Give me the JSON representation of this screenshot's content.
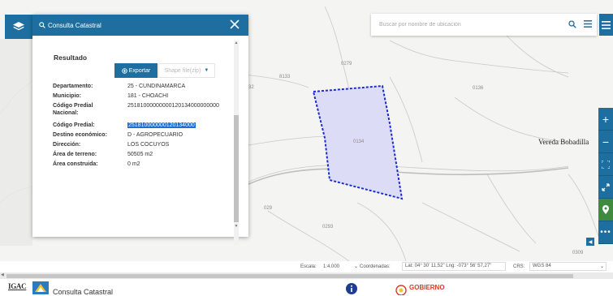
{
  "search": {
    "placeholder": "Buscar por nombre de ubicación"
  },
  "panel": {
    "title": "Consulta Catastral",
    "result_title": "Resultado",
    "export_label": "Exportar",
    "shape_label": "Shape file(zip)",
    "fields": [
      {
        "label": "Departamento:",
        "value": "25 - CUNDINAMARCA"
      },
      {
        "label": "Municipio:",
        "value": "181 - CHOACHÍ"
      },
      {
        "label": "Código Predial Nacional:",
        "value": "25181000000000120134000000000"
      },
      {
        "label": "Código Predial:",
        "value": "251810000000120134000"
      },
      {
        "label": "Destino económico:",
        "value": "D - AGROPECUARIO"
      },
      {
        "label": "Dirección:",
        "value": "LOS COCUYOS"
      },
      {
        "label": "Área de terreno:",
        "value": "50505 m2"
      },
      {
        "label": "Área construida:",
        "value": "0 m2"
      }
    ]
  },
  "map": {
    "labels": [
      "0279",
      "8133",
      "0136",
      "32",
      "0134",
      "029",
      "0293",
      "0309"
    ],
    "place_name": "Vereda Bobadilla",
    "polygon_fill": "#dcdcf7",
    "polygon_stroke": "#1c2bd0"
  },
  "statusbar": {
    "scale_label": "Escala:",
    "scale_value": "1:4.000",
    "coord_label": "Coordenadas:",
    "coord_value": "Lat: 04° 30' 11,52\" Lng: -073° 56' 57,27\"",
    "crs_label": "CRS:",
    "crs_value": "WGS 84"
  },
  "footer": {
    "org": "IGAC",
    "title": "Consulta Catastral",
    "gov": "GOBIERNO"
  },
  "colors": {
    "primary": "#1e6f9f",
    "green": "#3f8a3f",
    "selection": "#1a6fd0"
  }
}
